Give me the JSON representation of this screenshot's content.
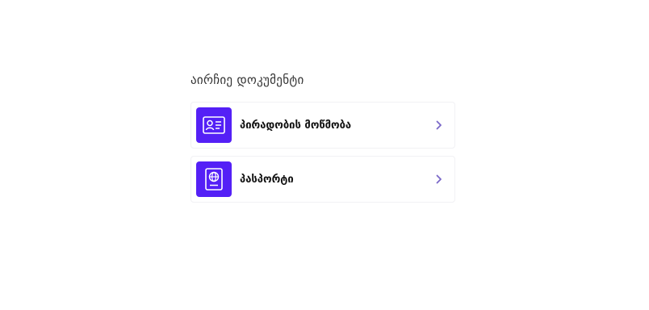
{
  "heading": "აირჩიე დოკუმენტი",
  "documents": [
    {
      "label": "პირადობის მოწმობა",
      "icon": "id-card-icon"
    },
    {
      "label": "პასპორტი",
      "icon": "passport-icon"
    }
  ],
  "colors": {
    "accent": "#5420f6",
    "chevron": "#7a68c8",
    "text": "#111111",
    "heading": "#333333",
    "border": "#f1f1f4"
  }
}
